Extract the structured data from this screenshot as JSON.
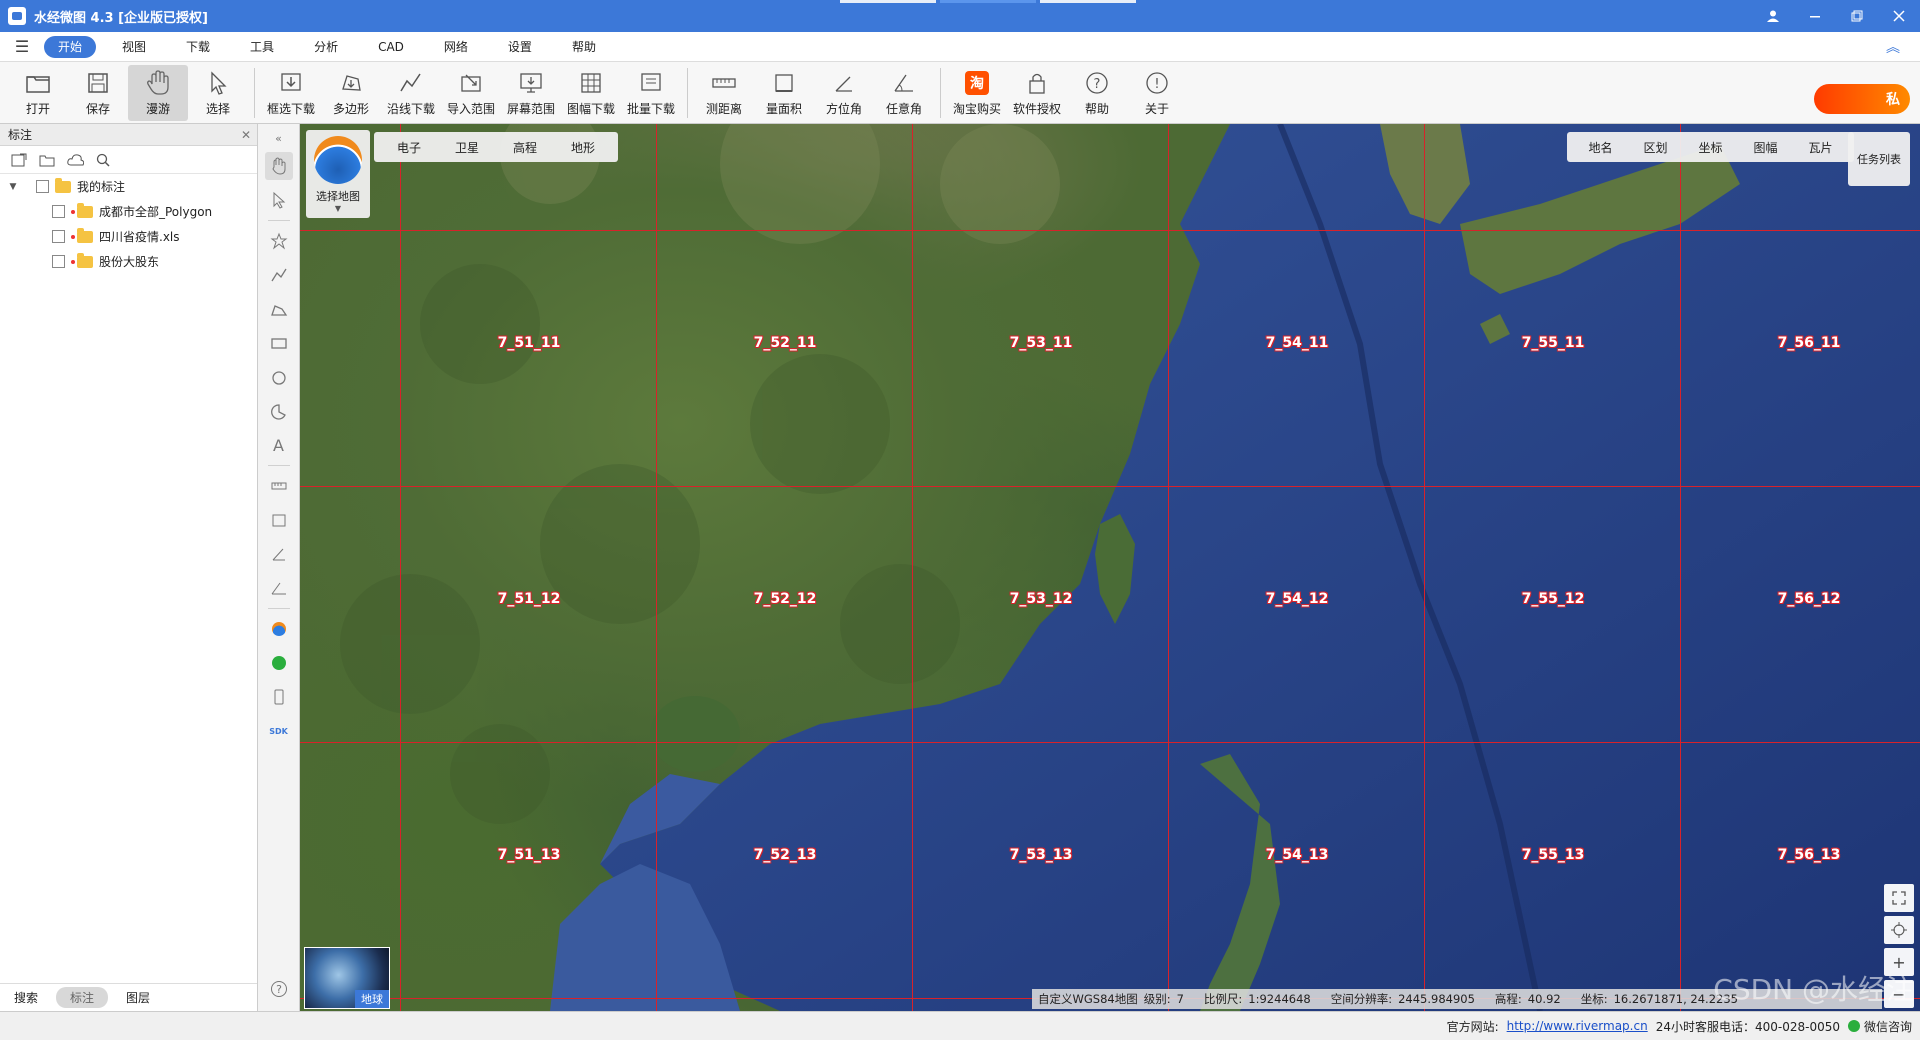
{
  "window": {
    "title": "水经微图 4.3 [企业版已授权]",
    "buttons": [
      "user-icon",
      "minimize-icon",
      "restore-icon",
      "close-icon"
    ]
  },
  "menu": {
    "items": [
      "开始",
      "视图",
      "下载",
      "工具",
      "分析",
      "CAD",
      "网络",
      "设置",
      "帮助"
    ],
    "active": "开始"
  },
  "ribbon": {
    "buttons": [
      {
        "label": "打开",
        "icon": "folder-open-icon"
      },
      {
        "label": "保存",
        "icon": "save-icon"
      },
      {
        "label": "漫游",
        "icon": "hand-icon",
        "active": true
      },
      {
        "label": "选择",
        "icon": "cursor-icon"
      },
      {
        "label": "框选下载",
        "icon": "box-download-icon"
      },
      {
        "label": "多边形",
        "icon": "polygon-icon"
      },
      {
        "label": "沿线下载",
        "icon": "line-download-icon"
      },
      {
        "label": "导入范围",
        "icon": "import-range-icon"
      },
      {
        "label": "屏幕范围",
        "icon": "screen-range-icon"
      },
      {
        "label": "图幅下载",
        "icon": "sheet-download-icon"
      },
      {
        "label": "批量下载",
        "icon": "batch-download-icon"
      },
      {
        "label": "测距离",
        "icon": "ruler-icon"
      },
      {
        "label": "量面积",
        "icon": "area-icon"
      },
      {
        "label": "方位角",
        "icon": "azimuth-icon"
      },
      {
        "label": "任意角",
        "icon": "angle-icon"
      },
      {
        "label": "淘宝购买",
        "icon": "taobao-icon"
      },
      {
        "label": "软件授权",
        "icon": "lock-icon"
      },
      {
        "label": "帮助",
        "icon": "question-icon"
      },
      {
        "label": "关于",
        "icon": "info-icon"
      }
    ],
    "vip_label": "私"
  },
  "left_panel": {
    "title": "标注",
    "tree": {
      "root": "我的标注",
      "children": [
        "成都市全部_Polygon",
        "四川省疫情.xls",
        "股份大股东"
      ]
    },
    "tabs": [
      "搜索",
      "标注",
      "图层"
    ],
    "active_tab": "标注"
  },
  "map": {
    "select_label": "选择地图",
    "map_types": [
      "电子",
      "卫星",
      "高程",
      "地形"
    ],
    "overlays": [
      "地名",
      "区划",
      "坐标",
      "图幅",
      "瓦片"
    ],
    "task_list": "任务列表",
    "globe_label": "地球",
    "tile_labels": [
      [
        "7_51_11",
        "7_52_11",
        "7_53_11",
        "7_54_11",
        "7_55_11",
        "7_56_11"
      ],
      [
        "7_51_12",
        "7_52_12",
        "7_53_12",
        "7_54_12",
        "7_55_12",
        "7_56_12"
      ],
      [
        "7_51_13",
        "7_52_13",
        "7_53_13",
        "7_54_13",
        "7_55_13",
        "7_56_13"
      ]
    ],
    "status": {
      "crs": "自定义WGS84地图",
      "level_label": "级别:",
      "level": "7",
      "scale_label": "比例尺:",
      "scale": "1:9244648",
      "resolution_label": "空间分辨率:",
      "resolution": "2445.984905",
      "elevation_label": "高程:",
      "elevation": "40.92",
      "coord_label": "坐标:",
      "coords": "16.2671871, 24.2235"
    },
    "watermark": "CSDN @水经注"
  },
  "statusbar": {
    "site_label": "官方网站:",
    "site_url": "http://www.rivermap.cn",
    "hotline": "24小时客服电话：400-028-0050",
    "wechat": "微信咨询"
  },
  "colors": {
    "accent": "#3c78d8",
    "grid_line": "#d8222a",
    "vip": "#ff5a00"
  }
}
